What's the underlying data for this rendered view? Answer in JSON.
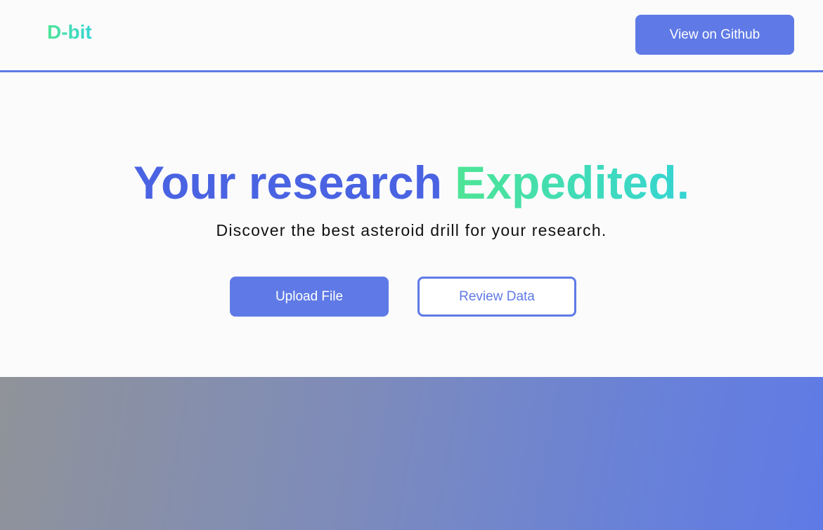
{
  "header": {
    "logo": "D-bit",
    "github_button": "View on Github"
  },
  "hero": {
    "title_part1": "Your research",
    "title_part2": "Expedited.",
    "subtitle": "Discover the best asteroid drill for your research.",
    "upload_button": "Upload File",
    "review_button": "Review Data"
  },
  "colors": {
    "primary": "#5f7ae6",
    "title_blue": "#4a63e2",
    "accent_green": "#4ee595",
    "accent_teal": "#35d4d4"
  }
}
